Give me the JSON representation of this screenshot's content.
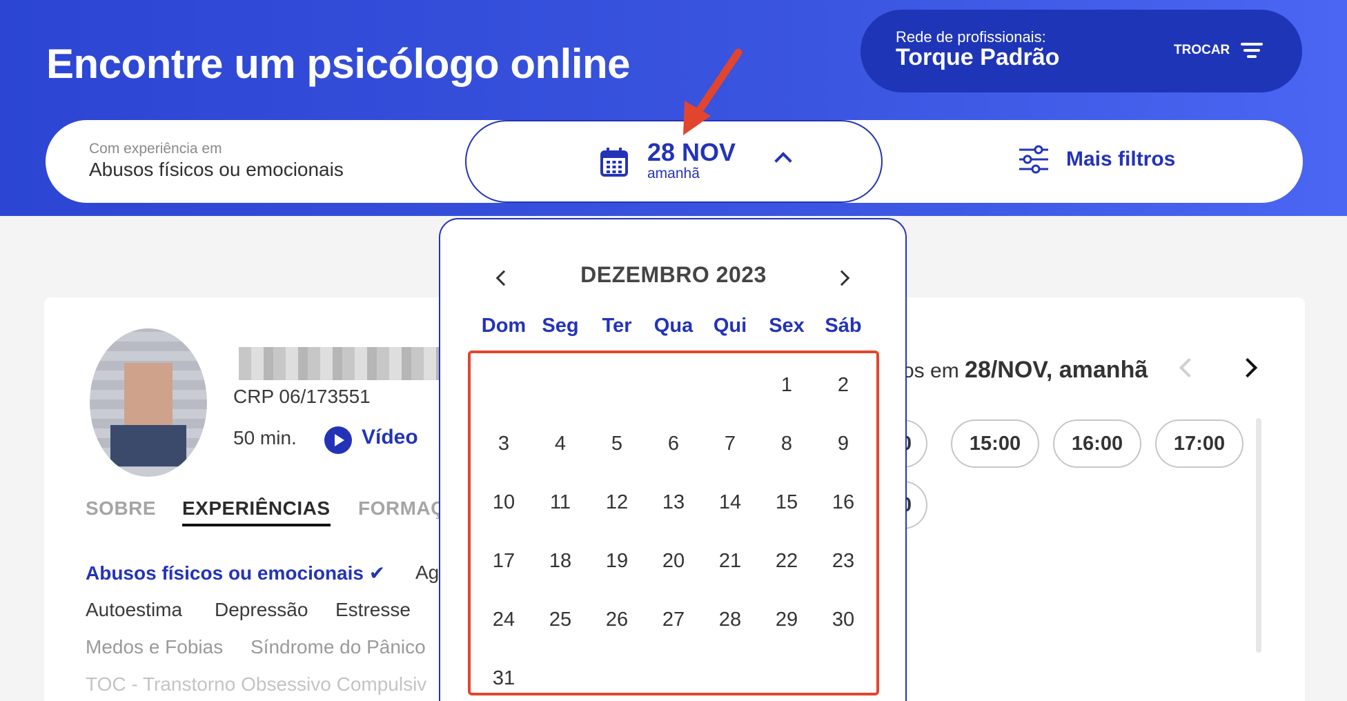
{
  "header": {
    "title": "Encontre um psicólogo online",
    "network_label": "Rede de profissionais:",
    "network_name": "Torque Padrão",
    "swap_label": "TROCAR"
  },
  "search": {
    "experience_label": "Com experiência em",
    "experience_value": "Abusos físicos ou emocionais",
    "date_main": "28 NOV",
    "date_sub": "amanhã",
    "filters_label": "Mais filtros"
  },
  "colors": {
    "brand": "#2333b8",
    "header_bg": "#3a55e0",
    "annotation": "#e2452e"
  },
  "calendar": {
    "month_title": "DEZEMBRO 2023",
    "weekdays": [
      "Dom",
      "Seg",
      "Ter",
      "Qua",
      "Qui",
      "Sex",
      "Sáb"
    ],
    "weeks": [
      [
        "",
        "",
        "",
        "",
        "",
        "1",
        "2"
      ],
      [
        "3",
        "4",
        "5",
        "6",
        "7",
        "8",
        "9"
      ],
      [
        "10",
        "11",
        "12",
        "13",
        "14",
        "15",
        "16"
      ],
      [
        "17",
        "18",
        "19",
        "20",
        "21",
        "22",
        "23"
      ],
      [
        "24",
        "25",
        "26",
        "27",
        "28",
        "29",
        "30"
      ],
      [
        "31",
        "",
        "",
        "",
        "",
        "",
        ""
      ]
    ]
  },
  "profile": {
    "crp": "CRP 06/173551",
    "duration": "50 min.",
    "session_type": "Vídeo",
    "tabs": [
      "SOBRE",
      "EXPERIÊNCIAS",
      "FORMAÇ"
    ],
    "tags": {
      "highlight": "Abusos físicos ou emocionais ✔",
      "row1_extra": "Ag",
      "row2": [
        "Autoestima",
        "Depressão",
        "Estresse"
      ],
      "row3": [
        "Medos e Fobias",
        "Síndrome do Pânico"
      ],
      "row4": "TOC - Transtorno Obsessivo Compulsiv"
    }
  },
  "slots": {
    "title_prefix": "os em",
    "title_date": "28/NOV, amanhã",
    "row1": [
      "0",
      "15:00",
      "16:00",
      "17:00"
    ],
    "row2": [
      "0"
    ]
  }
}
